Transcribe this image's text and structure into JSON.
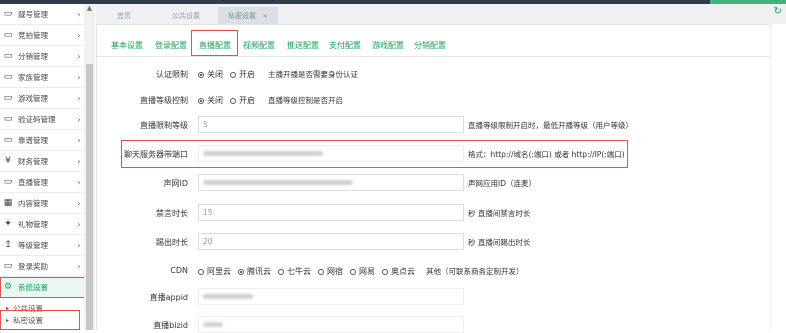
{
  "sidebar": {
    "items": [
      {
        "label": "靓号管理",
        "icon": "monitor-icon"
      },
      {
        "label": "竞拍管理",
        "icon": "monitor-icon"
      },
      {
        "label": "分销管理",
        "icon": "monitor-icon"
      },
      {
        "label": "家族管理",
        "icon": "monitor-icon"
      },
      {
        "label": "游戏管理",
        "icon": "monitor-icon"
      },
      {
        "label": "验证码管理",
        "icon": "monitor-icon"
      },
      {
        "label": "靠谱管理",
        "icon": "monitor-icon"
      },
      {
        "label": "财务管理",
        "icon": "yen-icon"
      },
      {
        "label": "直播管理",
        "icon": "monitor-icon"
      },
      {
        "label": "内容管理",
        "icon": "grid-icon"
      },
      {
        "label": "礼物管理",
        "icon": "gift-icon"
      },
      {
        "label": "等级管理",
        "icon": "level-icon"
      },
      {
        "label": "登录奖励",
        "icon": "monitor-icon"
      },
      {
        "label": "系统设置",
        "icon": "gear-icon"
      }
    ],
    "subitems": [
      "公共设置",
      "私密设置"
    ]
  },
  "tabs": {
    "page_tabs": [
      "首页",
      "公共设置",
      "私密设置"
    ],
    "close_symbol": "×"
  },
  "config_tabs": [
    "基本设置",
    "登录配置",
    "直播配置",
    "视频配置",
    "推送配置",
    "支付配置",
    "游戏配置",
    "分销配置"
  ],
  "form": {
    "auth": {
      "label": "认证限制",
      "off": "关闭",
      "on": "开启",
      "hint": "主播开播是否需要身份认证"
    },
    "level_ctrl": {
      "label": "直播等级控制",
      "off": "关闭",
      "on": "开启",
      "hint": "直播等级控制是否开启"
    },
    "level_limit": {
      "label": "直播限制等级",
      "value": "5",
      "hint": "直播等级限制开启时，最低开播等级（用户等级）"
    },
    "chat_server": {
      "label": "聊天服务器带端口",
      "hint": "格式：http://域名(:端口) 或者 http://IP(:端口)"
    },
    "sound_id": {
      "label": "声网ID",
      "hint": "声网应用ID（连麦）"
    },
    "ban_time": {
      "label": "禁言时长",
      "value": "15",
      "hint": "秒 直播间禁言时长"
    },
    "kick_time": {
      "label": "踢出时长",
      "value": "20",
      "hint": "秒 直播间踢出时长"
    },
    "cdn": {
      "label": "CDN",
      "options": [
        "阿里云",
        "腾讯云",
        "七牛云",
        "网宿",
        "网易",
        "奥点云"
      ],
      "selected": 1,
      "hint": "其他（可联系商务定制开发）"
    },
    "appid": {
      "label": "直播appid"
    },
    "bizid": {
      "label": "直播bizid"
    }
  },
  "colors": {
    "accent": "#18a058",
    "highlight": "#e05252"
  }
}
